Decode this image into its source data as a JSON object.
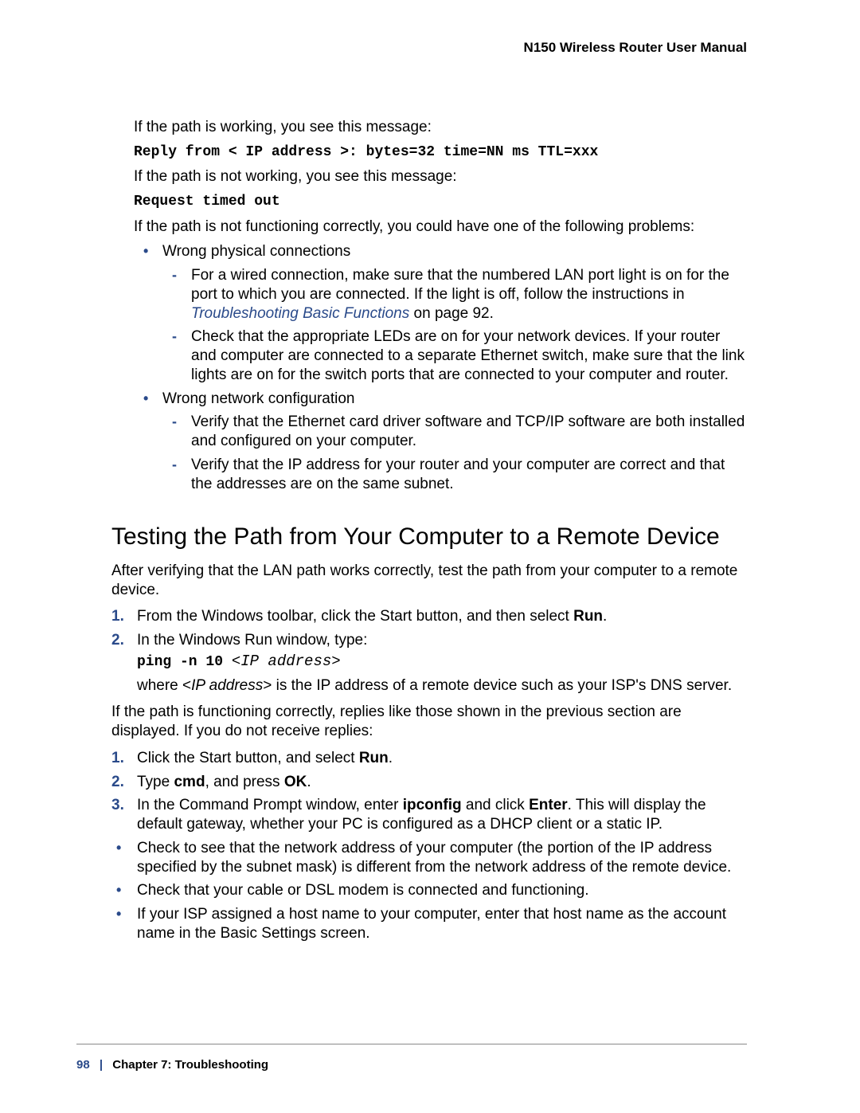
{
  "header": {
    "title": "N150 Wireless Router User Manual"
  },
  "body": {
    "p1": "If the path is working, you see this message:",
    "code1": "Reply from < IP address >: bytes=32 time=NN ms TTL=xxx",
    "p2": "If the path is not working, you see this message:",
    "code2": "Request timed out",
    "p3": "If the path is not functioning correctly, you could have one of the following problems:",
    "b1": "Wrong physical connections",
    "b1d1a": "For a wired connection, make sure that the numbered LAN port light is on for the port to which you are connected. If the light is off, follow the instructions in ",
    "b1d1link": "Troubleshooting Basic Functions",
    "b1d1b": " on page 92.",
    "b1d2": "Check that the appropriate LEDs are on for your network devices. If your router and computer are connected to a separate Ethernet switch, make sure that the link lights are on for the switch ports that are connected to your computer and router.",
    "b2": "Wrong network configuration",
    "b2d1": "Verify that the Ethernet card driver software and TCP/IP software are both installed and configured on your computer.",
    "b2d2": "Verify that the IP address for your router and your computer are correct and that the addresses are on the same subnet."
  },
  "section": {
    "title": "Testing the Path from Your Computer to a Remote Device",
    "intro": "After verifying that the LAN path works correctly, test the path from your computer to a remote device.",
    "s1a": "From the Windows toolbar, click the Start button, and then select ",
    "s1b": "Run",
    "s1c": ".",
    "s2a": "In the Windows Run window, type:",
    "s2code_a": "ping -n 10 ",
    "s2code_b": "<IP address>",
    "s2where_a": "where <",
    "s2where_ital": "IP address",
    "s2where_b": "> is the IP address of a remote device such as your ISP's DNS server.",
    "p4": "If the path is functioning correctly, replies like those shown in the previous section are displayed. If you do not receive replies:",
    "n1a": "Click the Start button, and select ",
    "n1b": "Run",
    "n1c": ".",
    "n2a": "Type ",
    "n2b": "cmd",
    "n2c": ", and press ",
    "n2d": "OK",
    "n2e": ".",
    "n3a": "In the Command Prompt window, enter ",
    "n3b": "ipconfig",
    "n3c": " and click ",
    "n3d": "Enter",
    "n3e": ". This will display the default gateway, whether your PC is configured as a DHCP client or a static IP.",
    "bl1": "Check to see that the network address of your computer (the portion of the IP address specified by the subnet mask) is different from the network address of the remote device.",
    "bl2": "Check that your cable or DSL modem is connected and functioning.",
    "bl3": "If your ISP assigned a host name to your computer, enter that host name as the account name in the Basic Settings screen."
  },
  "footer": {
    "page": "98",
    "chapter": "Chapter 7:  Troubleshooting"
  }
}
